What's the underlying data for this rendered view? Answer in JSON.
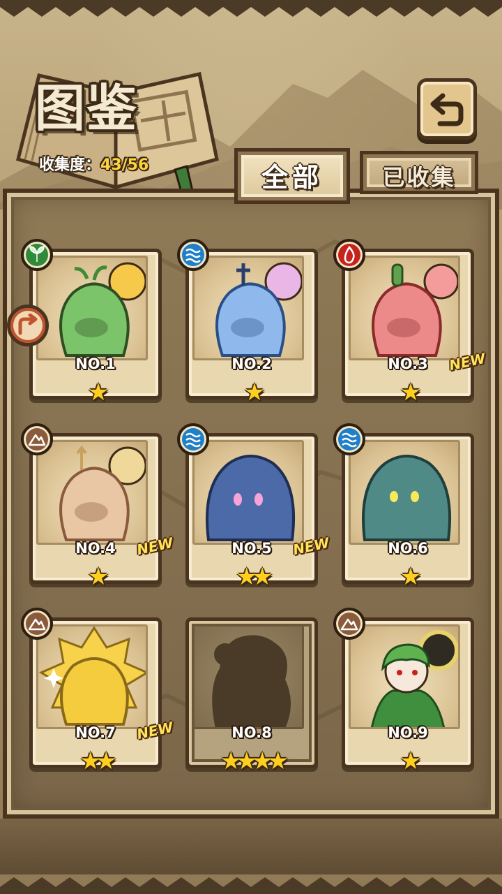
{
  "header": {
    "title": "图鉴",
    "collection_label": "收集度：",
    "collection_value": "43/56"
  },
  "tabs": [
    {
      "label": "全部",
      "active": true
    },
    {
      "label": "已收集",
      "active": false
    }
  ],
  "back_button": {
    "icon": "back-arrow-icon"
  },
  "side_button": {
    "icon": "arrow-turn-icon"
  },
  "new_label": "NEW",
  "cards": [
    {
      "number": "NO.1",
      "element": "grass",
      "stars": "★",
      "new": false,
      "color": "#7cc46a",
      "locked": false
    },
    {
      "number": "NO.2",
      "element": "water",
      "stars": "★",
      "new": false,
      "color": "#8fb8ec",
      "locked": false
    },
    {
      "number": "NO.3",
      "element": "fire",
      "stars": "★",
      "new": true,
      "color": "#ec8a8a",
      "locked": false
    },
    {
      "number": "NO.4",
      "element": "earth",
      "stars": "★",
      "new": true,
      "color": "#e9c7a4",
      "locked": false
    },
    {
      "number": "NO.5",
      "element": "water",
      "stars": "★★",
      "new": true,
      "color": "#4d6aa8",
      "locked": false
    },
    {
      "number": "NO.6",
      "element": "water",
      "stars": "★",
      "new": false,
      "color": "#4f8a86",
      "locked": false
    },
    {
      "number": "NO.7",
      "element": "earth",
      "stars": "★★",
      "new": true,
      "color": "#f4cc3e",
      "locked": false
    },
    {
      "number": "NO.8",
      "element": "",
      "stars": "★★★★",
      "new": false,
      "color": "#4a3b28",
      "locked": true
    },
    {
      "number": "NO.9",
      "element": "earth",
      "stars": "★",
      "new": false,
      "color": "#3f8f3f",
      "locked": false
    }
  ],
  "colors": {
    "grass": "#2f8a3a",
    "water": "#1f7fc7",
    "fire": "#c7231e",
    "earth": "#8a5a3c",
    "star": "#ffcf1f",
    "highlight": "#ffd33a"
  }
}
